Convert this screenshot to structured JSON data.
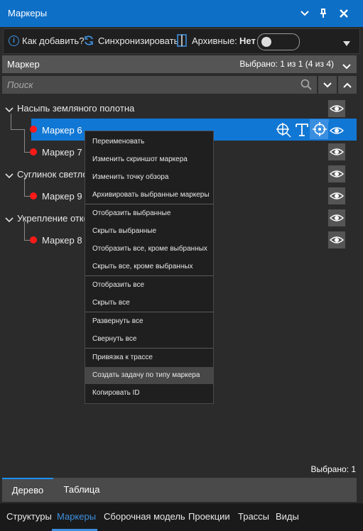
{
  "window": {
    "title": "Маркеры"
  },
  "toolbar": {
    "how_to_add": "Как добавить?",
    "sync": "Синхронизировать",
    "archived_label": "Архивные:",
    "archived_value": "Нет"
  },
  "header": {
    "label": "Маркер",
    "selected": "Выбрано: 1 из 1 (4 из 4)"
  },
  "search": {
    "placeholder": "Поиск"
  },
  "tree": {
    "groups": [
      {
        "label": "Насыпь земляного полотна",
        "markers": [
          {
            "label": "Маркер 6",
            "selected": true
          },
          {
            "label": "Маркер 7"
          }
        ]
      },
      {
        "label": "Суглинок светло-",
        "markers": [
          {
            "label": "Маркер 9"
          }
        ]
      },
      {
        "label": "Укрепление отко",
        "markers": [
          {
            "label": "Маркер 8"
          }
        ]
      }
    ]
  },
  "context_menu": {
    "items": [
      "Переименовать",
      "Изменить скриншот маркера",
      "Изменить точку обзора",
      "Архивировать выбранные маркеры",
      "Отобразить выбранные",
      "Скрыть выбранные",
      "Отобразить все, кроме выбранных",
      "Скрыть все, кроме выбранных",
      "Отобразить все",
      "Скрыть все",
      "Развернуть все",
      "Свернуть все",
      "Привязка к трассе",
      "Создать задачу по типу маркера",
      "Копировать ID"
    ],
    "highlighted_index": 13
  },
  "footer": {
    "selected": "Выбрано: 1"
  },
  "tabs": [
    "Дерево",
    "Таблица"
  ],
  "bottom_nav": [
    "Структуры",
    "Маркеры",
    "Сборочная модель",
    "Проекции",
    "Трассы",
    "Виды"
  ],
  "colors": {
    "accent": "#0e6fc7",
    "selection": "#1177d4",
    "marker_dot": "#ff1a1a"
  },
  "icons": [
    "info-icon",
    "sync-icon",
    "archive-icon",
    "chevron-down-icon",
    "pin-icon",
    "close-icon",
    "search-icon",
    "chevron-up-icon",
    "eye-icon",
    "target-icon",
    "text-icon",
    "crosshair-icon"
  ]
}
